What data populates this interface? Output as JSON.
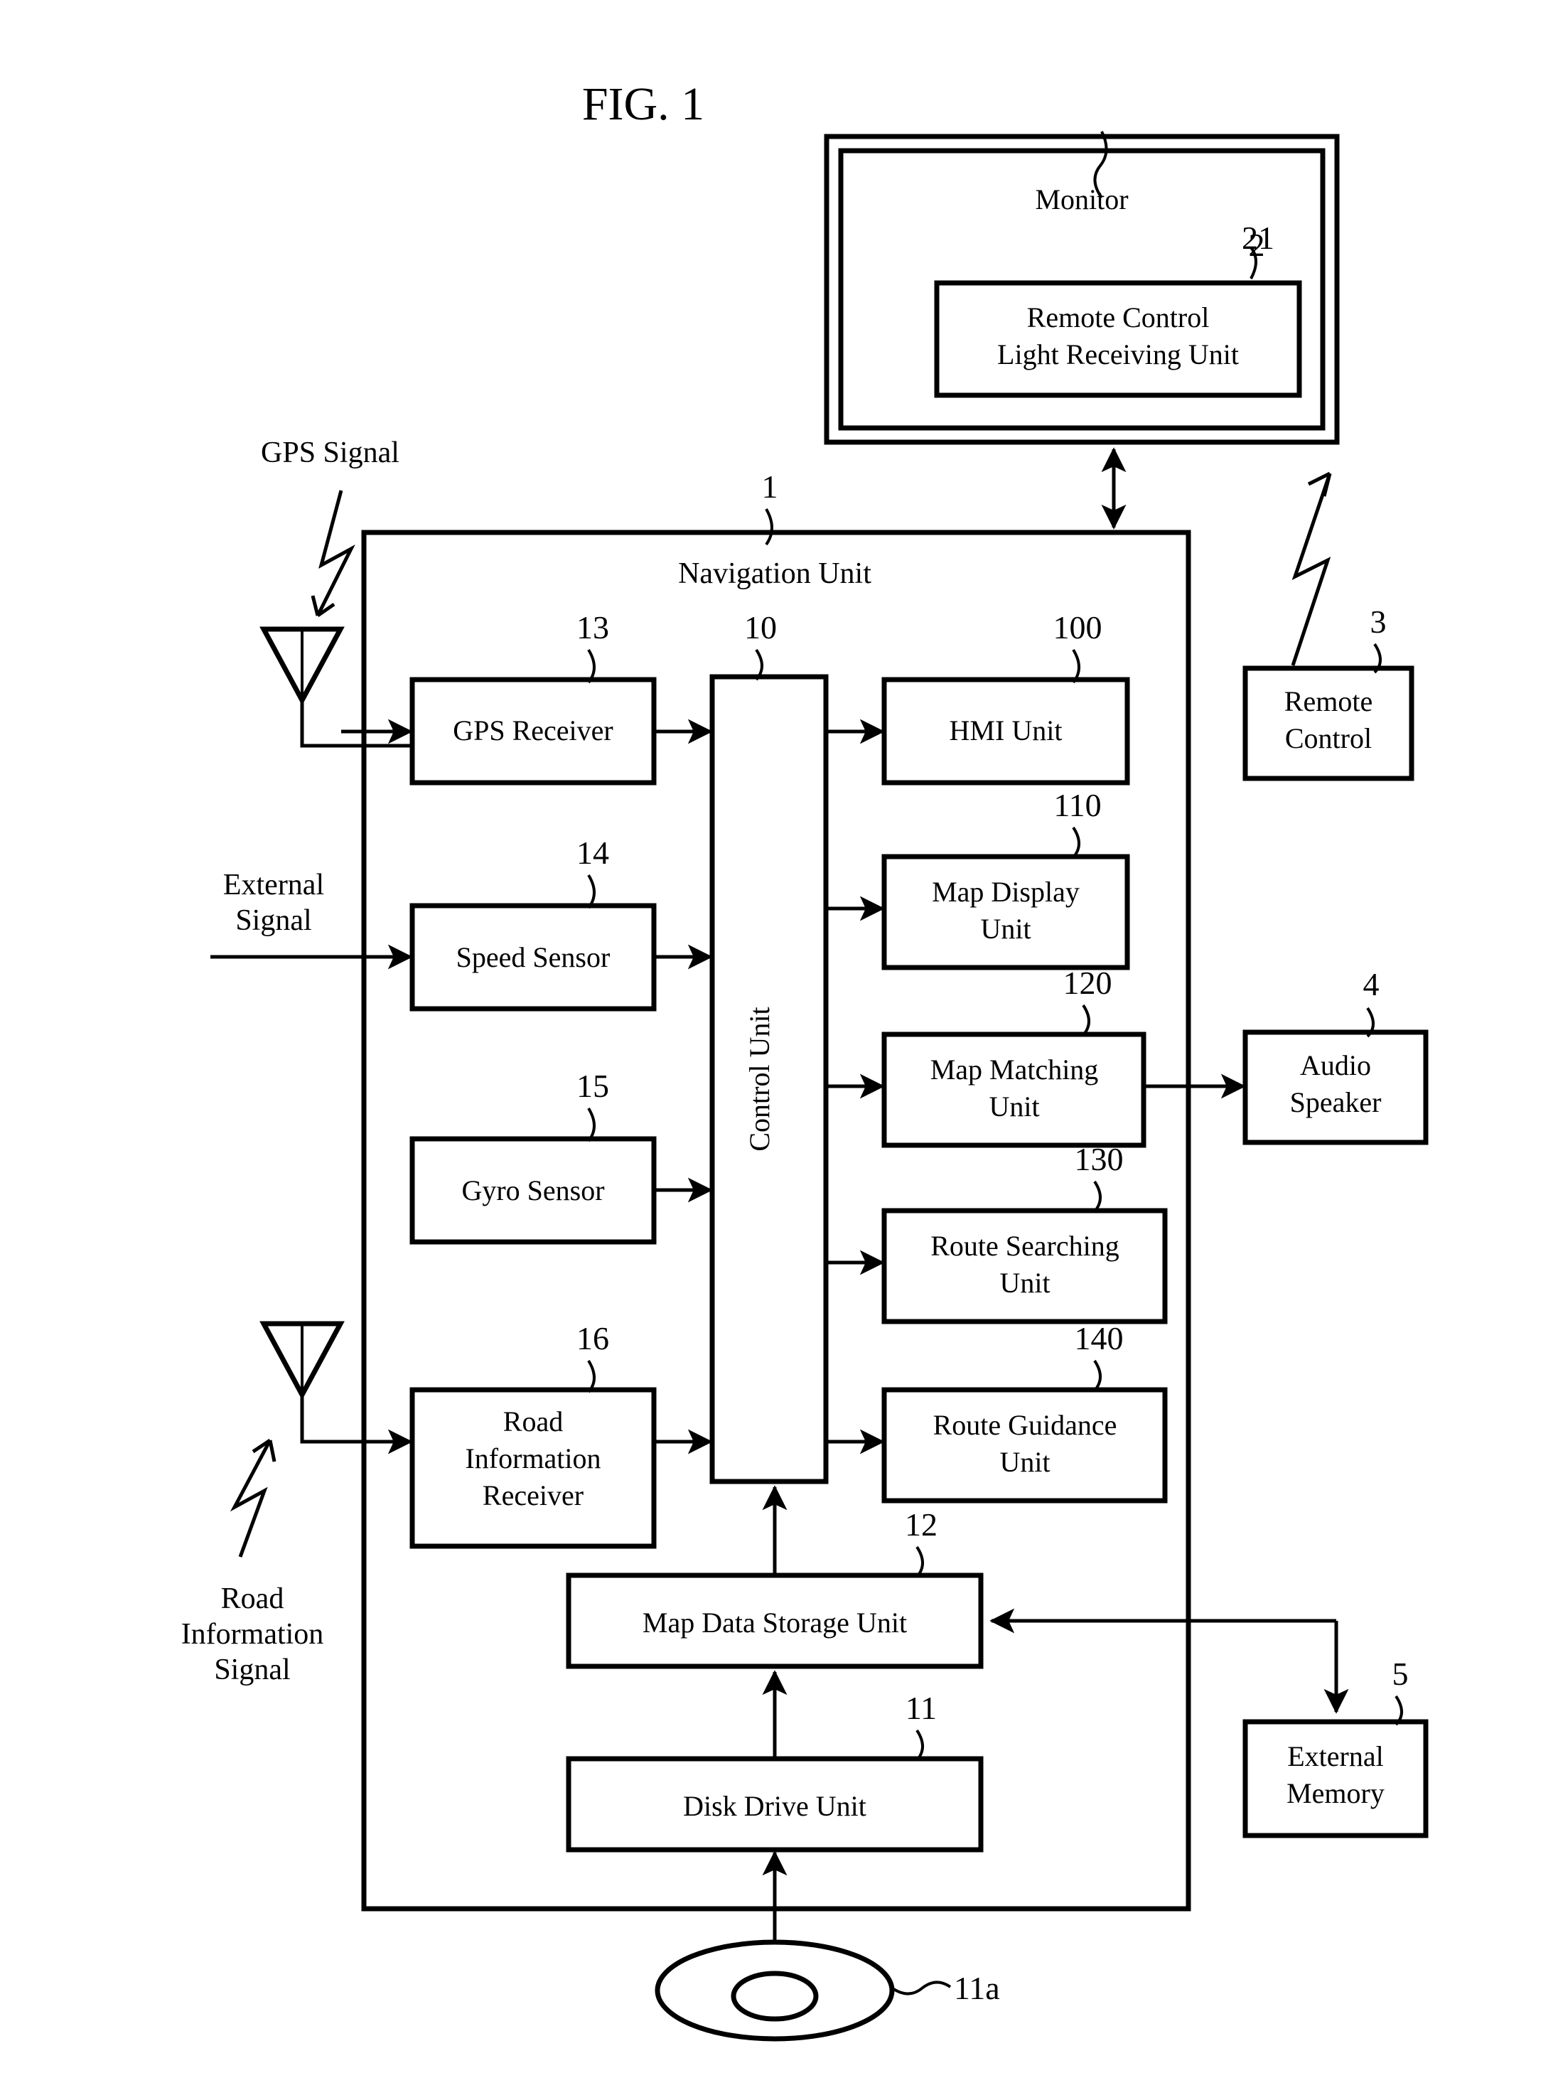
{
  "figure": {
    "title": "FIG. 1"
  },
  "external_labels": {
    "gps_signal": "GPS Signal",
    "external_signal_line1": "External",
    "external_signal_line2": "Signal",
    "road_signal_line1": "Road",
    "road_signal_line2": "Information",
    "road_signal_line3": "Signal"
  },
  "monitor": {
    "label": "Monitor",
    "ref": "2",
    "receiver": {
      "line1": "Remote Control",
      "line2": "Light Receiving Unit",
      "ref": "21"
    }
  },
  "navigation_unit": {
    "label": "Navigation Unit",
    "ref": "1"
  },
  "control_unit": {
    "label": "Control Unit",
    "ref": "10"
  },
  "input_blocks": [
    {
      "label": "GPS Receiver",
      "ref": "13",
      "lines": [
        "GPS Receiver"
      ]
    },
    {
      "label": "Speed Sensor",
      "ref": "14",
      "lines": [
        "Speed Sensor"
      ]
    },
    {
      "label": "Gyro Sensor",
      "ref": "15",
      "lines": [
        "Gyro Sensor"
      ]
    },
    {
      "label": "Road Information Receiver",
      "ref": "16",
      "lines": [
        "Road",
        "Information",
        "Receiver"
      ]
    }
  ],
  "output_blocks": [
    {
      "label": "HMI Unit",
      "ref": "100",
      "lines": [
        "HMI Unit"
      ]
    },
    {
      "label": "Map Display Unit",
      "ref": "110",
      "lines": [
        "Map Display",
        "Unit"
      ]
    },
    {
      "label": "Map Matching Unit",
      "ref": "120",
      "lines": [
        "Map Matching",
        "Unit"
      ]
    },
    {
      "label": "Route Searching Unit",
      "ref": "130",
      "lines": [
        "Route Searching",
        "Unit"
      ]
    },
    {
      "label": "Route Guidance Unit",
      "ref": "140",
      "lines": [
        "Route Guidance",
        "Unit"
      ]
    }
  ],
  "storage_blocks": [
    {
      "label": "Map Data Storage Unit",
      "ref": "12",
      "lines": [
        "Map Data Storage Unit"
      ]
    },
    {
      "label": "Disk Drive Unit",
      "ref": "11",
      "lines": [
        "Disk Drive Unit"
      ]
    }
  ],
  "disc": {
    "ref": "11a"
  },
  "peripherals": [
    {
      "label": "Remote Control",
      "ref": "3",
      "lines": [
        "Remote",
        "Control"
      ]
    },
    {
      "label": "Audio Speaker",
      "ref": "4",
      "lines": [
        "Audio",
        "Speaker"
      ]
    },
    {
      "label": "External Memory",
      "ref": "5",
      "lines": [
        "External",
        "Memory"
      ]
    }
  ],
  "colors": {
    "ink": "#000000",
    "paper": "#ffffff"
  }
}
